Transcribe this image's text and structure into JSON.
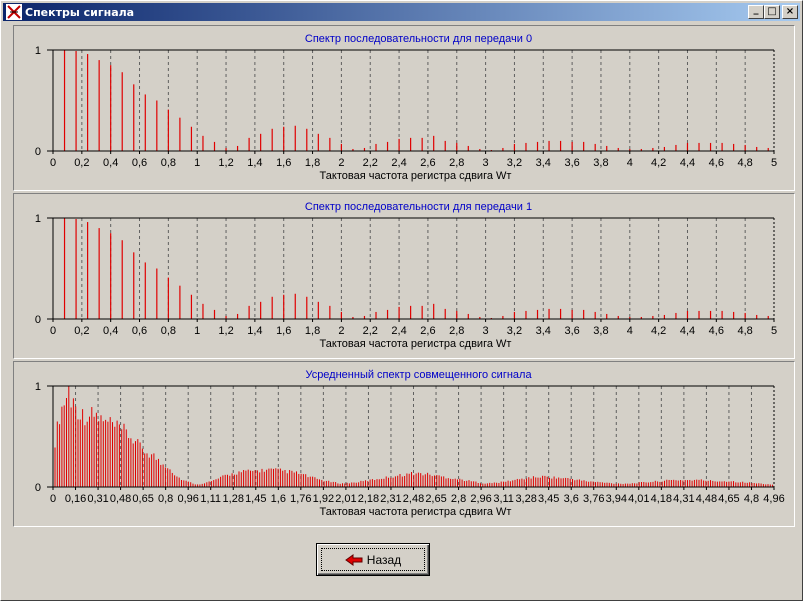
{
  "window": {
    "title": "Спектры сигнала",
    "controls": {
      "minimize": "_",
      "maximize": "□",
      "close": "×"
    }
  },
  "back_button": {
    "label": "Назад",
    "icon": "red-left-arrow-icon"
  },
  "colors": {
    "bars": "#e00000",
    "title": "#0000c8",
    "titlebar_start": "#0a246a",
    "titlebar_end": "#a6caf0"
  },
  "chart_data": [
    {
      "type": "bar",
      "title": "Спектр  последовательности для передачи 0",
      "xlabel": "Тактовая частота регистра сдвига Wт",
      "ylabel": "",
      "xlim": [
        0,
        5
      ],
      "ylim": [
        0,
        1
      ],
      "y_ticks": [
        "0",
        "1"
      ],
      "x_tick_labels": [
        "0",
        "0,2",
        "0,4",
        "0,6",
        "0,8",
        "1",
        "1,2",
        "1,4",
        "1,6",
        "1,8",
        "2",
        "2,2",
        "2,4",
        "2,6",
        "2,8",
        "3",
        "3,2",
        "3,4",
        "3,6",
        "3,8",
        "4",
        "4,2",
        "4,4",
        "4,6",
        "4,8",
        "5"
      ],
      "grid": "vertical dashed",
      "x": [
        0.08,
        0.16,
        0.24,
        0.32,
        0.4,
        0.48,
        0.56,
        0.64,
        0.72,
        0.8,
        0.88,
        0.96,
        1.04,
        1.12,
        1.2,
        1.28,
        1.36,
        1.44,
        1.52,
        1.6,
        1.68,
        1.76,
        1.84,
        1.92,
        2.0,
        2.08,
        2.16,
        2.24,
        2.32,
        2.4,
        2.48,
        2.56,
        2.64,
        2.72,
        2.8,
        2.88,
        2.96,
        3.04,
        3.12,
        3.2,
        3.28,
        3.36,
        3.44,
        3.52,
        3.6,
        3.68,
        3.76,
        3.84,
        3.92,
        4.0,
        4.08,
        4.16,
        4.24,
        4.32,
        4.4,
        4.48,
        4.56,
        4.64,
        4.72,
        4.8,
        4.88,
        4.96
      ],
      "values": [
        1.0,
        0.99,
        0.96,
        0.9,
        0.85,
        0.78,
        0.66,
        0.56,
        0.5,
        0.41,
        0.33,
        0.24,
        0.15,
        0.09,
        0.03,
        0.05,
        0.13,
        0.17,
        0.22,
        0.24,
        0.25,
        0.22,
        0.17,
        0.13,
        0.07,
        0.02,
        0.03,
        0.07,
        0.09,
        0.12,
        0.13,
        0.13,
        0.15,
        0.1,
        0.08,
        0.05,
        0.02,
        0.01,
        0.03,
        0.07,
        0.08,
        0.09,
        0.1,
        0.1,
        0.09,
        0.09,
        0.07,
        0.05,
        0.03,
        0.02,
        0.02,
        0.03,
        0.04,
        0.06,
        0.08,
        0.08,
        0.08,
        0.08,
        0.07,
        0.06,
        0.04,
        0.03
      ]
    },
    {
      "type": "bar",
      "title": "Спектр последовательности для передачи 1",
      "xlabel": "Тактовая частота регистра сдвига Wт",
      "ylabel": "",
      "xlim": [
        0,
        5
      ],
      "ylim": [
        0,
        1
      ],
      "y_ticks": [
        "0",
        "1"
      ],
      "x_tick_labels": [
        "0",
        "0,2",
        "0,4",
        "0,6",
        "0,8",
        "1",
        "1,2",
        "1,4",
        "1,6",
        "1,8",
        "2",
        "2,2",
        "2,4",
        "2,6",
        "2,8",
        "3",
        "3,2",
        "3,4",
        "3,6",
        "3,8",
        "4",
        "4,2",
        "4,4",
        "4,6",
        "4,8",
        "5"
      ],
      "grid": "vertical dashed",
      "x": [
        0.08,
        0.16,
        0.24,
        0.32,
        0.4,
        0.48,
        0.56,
        0.64,
        0.72,
        0.8,
        0.88,
        0.96,
        1.04,
        1.12,
        1.2,
        1.28,
        1.36,
        1.44,
        1.52,
        1.6,
        1.68,
        1.76,
        1.84,
        1.92,
        2.0,
        2.08,
        2.16,
        2.24,
        2.32,
        2.4,
        2.48,
        2.56,
        2.64,
        2.72,
        2.8,
        2.88,
        2.96,
        3.04,
        3.12,
        3.2,
        3.28,
        3.36,
        3.44,
        3.52,
        3.6,
        3.68,
        3.76,
        3.84,
        3.92,
        4.0,
        4.08,
        4.16,
        4.24,
        4.32,
        4.4,
        4.48,
        4.56,
        4.64,
        4.72,
        4.8,
        4.88,
        4.96
      ],
      "values": [
        1.0,
        0.99,
        0.96,
        0.9,
        0.85,
        0.78,
        0.66,
        0.56,
        0.5,
        0.41,
        0.33,
        0.24,
        0.15,
        0.09,
        0.03,
        0.05,
        0.13,
        0.17,
        0.22,
        0.24,
        0.25,
        0.22,
        0.17,
        0.13,
        0.07,
        0.02,
        0.03,
        0.07,
        0.09,
        0.12,
        0.13,
        0.13,
        0.15,
        0.1,
        0.08,
        0.05,
        0.02,
        0.01,
        0.03,
        0.07,
        0.08,
        0.09,
        0.1,
        0.1,
        0.09,
        0.09,
        0.07,
        0.05,
        0.03,
        0.02,
        0.02,
        0.03,
        0.04,
        0.06,
        0.08,
        0.08,
        0.08,
        0.08,
        0.07,
        0.06,
        0.04,
        0.03
      ]
    },
    {
      "type": "bar",
      "title": "Усредненный спектр совмещенного сигнала",
      "xlabel": "Тактовая частота регистра сдвига Wт",
      "ylabel": "",
      "xlim": [
        0,
        5
      ],
      "ylim": [
        0,
        1
      ],
      "y_ticks": [
        "0",
        "1"
      ],
      "x_tick_labels": [
        "0",
        "0,16",
        "0,31",
        "0,48",
        "0,65",
        "0,8",
        "0,96",
        "1,11",
        "1,28",
        "1,45",
        "1,6",
        "1,76",
        "1,92",
        "2,01",
        "2,18",
        "2,31",
        "2,48",
        "2,65",
        "2,8",
        "2,96",
        "3,11",
        "3,28",
        "3,45",
        "3,6",
        "3,76",
        "3,94",
        "4,01",
        "4,18",
        "4,31",
        "4,48",
        "4,65",
        "4,8",
        "4,96"
      ],
      "grid": "vertical dashed",
      "envelope": {
        "x": [
          0,
          0.05,
          0.1,
          0.15,
          0.2,
          0.25,
          0.3,
          0.35,
          0.4,
          0.45,
          0.5,
          0.55,
          0.6,
          0.65,
          0.7,
          0.75,
          0.8,
          0.85,
          0.9,
          0.95,
          1.0,
          1.1,
          1.2,
          1.3,
          1.4,
          1.5,
          1.6,
          1.7,
          1.8,
          1.9,
          2.0,
          2.1,
          2.2,
          2.3,
          2.4,
          2.5,
          2.6,
          2.7,
          2.8,
          2.9,
          3.0,
          3.1,
          3.2,
          3.3,
          3.4,
          3.5,
          3.6,
          3.7,
          3.8,
          3.9,
          4.0,
          4.1,
          4.2,
          4.3,
          4.4,
          4.5,
          4.6,
          4.7,
          4.8,
          4.9,
          5.0
        ],
        "values": [
          0.3,
          0.65,
          0.8,
          0.72,
          0.62,
          0.62,
          0.62,
          0.56,
          0.55,
          0.5,
          0.48,
          0.42,
          0.35,
          0.3,
          0.27,
          0.2,
          0.18,
          0.1,
          0.06,
          0.04,
          0.02,
          0.05,
          0.1,
          0.13,
          0.14,
          0.15,
          0.14,
          0.12,
          0.08,
          0.05,
          0.03,
          0.04,
          0.06,
          0.08,
          0.1,
          0.12,
          0.11,
          0.09,
          0.07,
          0.05,
          0.03,
          0.04,
          0.06,
          0.08,
          0.09,
          0.08,
          0.07,
          0.05,
          0.04,
          0.03,
          0.03,
          0.04,
          0.05,
          0.06,
          0.06,
          0.06,
          0.05,
          0.05,
          0.04,
          0.03,
          0.02
        ]
      }
    }
  ]
}
